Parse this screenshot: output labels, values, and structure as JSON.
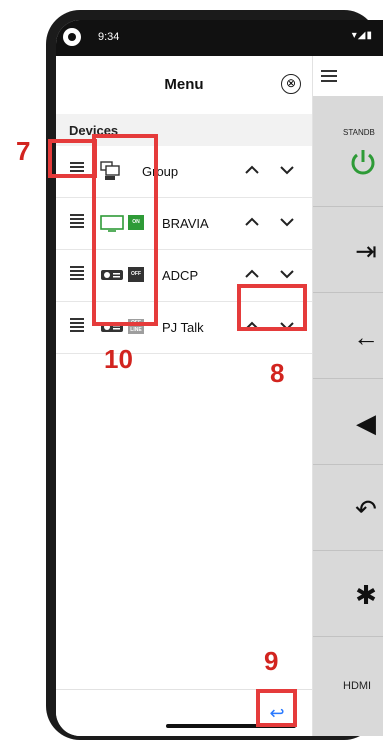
{
  "status_bar": {
    "time": "9:34",
    "icons": "▾◢▮"
  },
  "menu": {
    "title": "Menu",
    "close_icon": "⊗",
    "section": "Devices",
    "devices": [
      {
        "name": "Group",
        "icon": "group-icon",
        "badge": "",
        "badge_color": ""
      },
      {
        "name": "BRAVIA",
        "icon": "tv-icon",
        "badge": "ON",
        "badge_color": "#2e9b37"
      },
      {
        "name": "ADCP",
        "icon": "projector-icon",
        "badge": "OFF",
        "badge_color": "#333333"
      },
      {
        "name": "PJ Talk",
        "icon": "projector-icon",
        "badge": "OFF LINE",
        "badge_color": "#9e9e9e"
      }
    ],
    "back_icon": "↩"
  },
  "remote": {
    "standby_label": "STANDB",
    "hdmi_label": "HDMI",
    "buttons": [
      "power-icon",
      "input-icon",
      "left-arrow-icon",
      "send-icon",
      "return-icon",
      "mute-icon"
    ]
  },
  "callouts": {
    "c7": "7",
    "c8": "8",
    "c9": "9",
    "c10": "10"
  },
  "colors": {
    "accent_red": "#e53b3b",
    "on_green": "#2e9b37",
    "link_blue": "#2979ff"
  }
}
